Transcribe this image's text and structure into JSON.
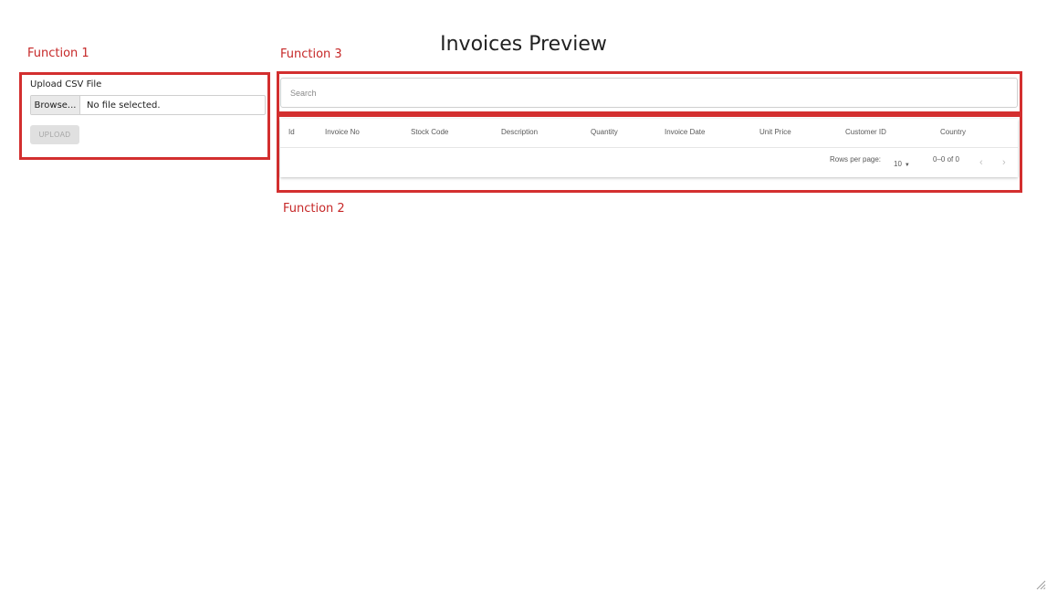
{
  "page": {
    "title": "Invoices Preview"
  },
  "annotations": {
    "function1": "Function 1",
    "function2": "Function 2",
    "function3": "Function 3"
  },
  "upload": {
    "label": "Upload CSV File",
    "browse_label": "Browse...",
    "file_status": "No file selected.",
    "upload_button": "UPLOAD"
  },
  "search": {
    "placeholder": "Search",
    "value": ""
  },
  "table": {
    "columns": [
      "Id",
      "Invoice No",
      "Stock Code",
      "Description",
      "Quantity",
      "Invoice Date",
      "Unit Price",
      "Customer ID",
      "Country"
    ],
    "rows": []
  },
  "pagination": {
    "rows_per_page_label": "Rows per page:",
    "rows_per_page_value": "10",
    "range_text": "0–0 of 0",
    "prev_icon": "chevron-left-icon",
    "next_icon": "chevron-right-icon"
  },
  "colors": {
    "annotation": "#d32f2f",
    "disabled_text": "#a6a6a6"
  }
}
